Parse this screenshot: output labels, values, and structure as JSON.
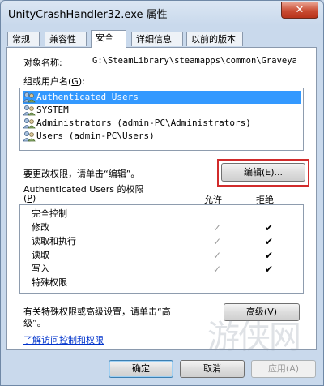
{
  "window": {
    "title": "UnityCrashHandler32.exe 属性",
    "close_label": "✕"
  },
  "tabs": [
    {
      "label": "常规"
    },
    {
      "label": "兼容性"
    },
    {
      "label": "安全"
    },
    {
      "label": "详细信息"
    },
    {
      "label": "以前的版本"
    }
  ],
  "security": {
    "object_name_label": "对象名称:",
    "object_name_value": "G:\\SteamLibrary\\steamapps\\common\\Graveya",
    "groups_label": "组或用户名(",
    "groups_accel": "G",
    "groups_label_end": "):",
    "users": [
      {
        "name": "Authenticated Users",
        "selected": true
      },
      {
        "name": "SYSTEM",
        "selected": false
      },
      {
        "name": "Administrators (admin-PC\\Administrators)",
        "selected": false
      },
      {
        "name": "Users (admin-PC\\Users)",
        "selected": false
      }
    ],
    "change_hint": "要更改权限，请单击“编辑”。",
    "edit_button": "编辑(E)...",
    "perm_header_line1": "Authenticated Users 的权限",
    "perm_header_line2_open": "(",
    "perm_header_accel": "P",
    "perm_header_line2_close": ")",
    "allow_label": "允许",
    "deny_label": "拒绝",
    "permissions": [
      {
        "name": "完全控制",
        "allow": false,
        "deny": false
      },
      {
        "name": "修改",
        "allow": true,
        "deny": true
      },
      {
        "name": "读取和执行",
        "allow": true,
        "deny": true
      },
      {
        "name": "读取",
        "allow": true,
        "deny": true
      },
      {
        "name": "写入",
        "allow": true,
        "deny": true
      },
      {
        "name": "特殊权限",
        "allow": false,
        "deny": false
      }
    ],
    "advanced_hint_line1": "有关特殊权限或高级设置，请单击“高",
    "advanced_hint_line2": "级”。",
    "advanced_button": "高级(V)",
    "learn_link": "了解访问控制和权限"
  },
  "footer": {
    "ok": "确定",
    "cancel": "取消",
    "apply": "应用(A)"
  },
  "watermark": "游侠网"
}
